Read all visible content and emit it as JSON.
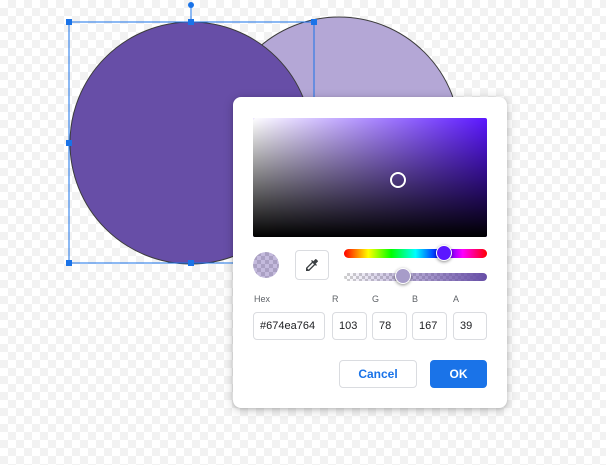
{
  "colors": {
    "circle_front": "#674EA7",
    "circle_back": "#B4A7D6",
    "selection": "#1A73E8",
    "hue_base": "#5B17FF",
    "current_color": "#674EA7",
    "accent": "#1A73E8"
  },
  "picker": {
    "hue_position": 0.69,
    "alpha_position": 0.39,
    "labels": {
      "hex": "Hex",
      "r": "R",
      "g": "G",
      "b": "B",
      "a": "A"
    },
    "values": {
      "hex": "#674ea764",
      "r": "103",
      "g": "78",
      "b": "167",
      "a": "39"
    },
    "eyedropper_icon": "eyedropper-icon",
    "cancel_label": "Cancel",
    "ok_label": "OK"
  }
}
